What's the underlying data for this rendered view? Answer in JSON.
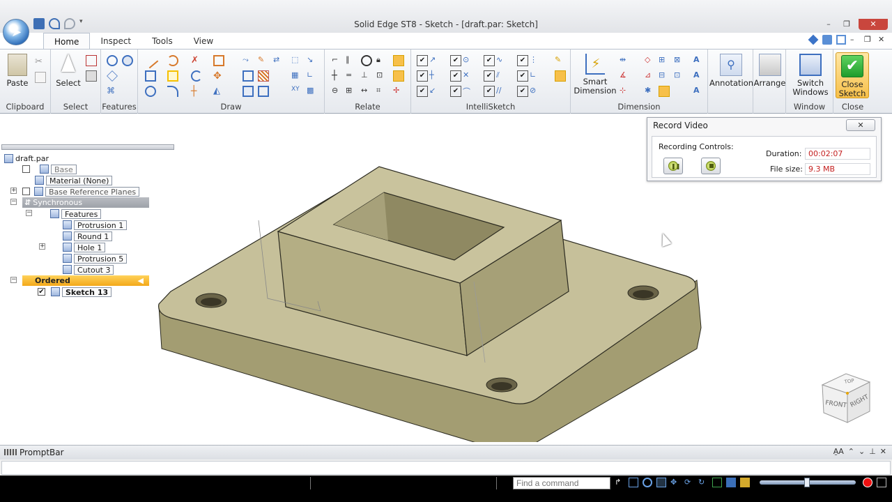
{
  "window": {
    "title": "Solid Edge ST8 - Sketch - [draft.par: Sketch]",
    "minimize": "–",
    "restore": "❐",
    "close": "✕"
  },
  "tabs": [
    {
      "label": "Home",
      "active": true
    },
    {
      "label": "Inspect"
    },
    {
      "label": "Tools"
    },
    {
      "label": "View"
    }
  ],
  "ribbon": {
    "groups": {
      "clipboard": "Clipboard",
      "select": "Select",
      "features": "Features",
      "draw": "Draw",
      "relate": "Relate",
      "intellisketch": "IntelliSketch",
      "dimension": "Dimension",
      "window": "Window",
      "close": "Close"
    },
    "buttons": {
      "paste": "Paste",
      "select": "Select",
      "smart_dimension_1": "Smart",
      "smart_dimension_2": "Dimension",
      "annotation": "Annotation",
      "arrange": "Arrange",
      "switch_windows_1": "Switch",
      "switch_windows_2": "Windows",
      "close_sketch_1": "Close",
      "close_sketch_2": "Sketch"
    }
  },
  "tree": {
    "root": "draft.par",
    "items": {
      "base": "Base",
      "material": "Material (None)",
      "base_ref_planes": "Base Reference Planes",
      "synchronous": "Synchronous",
      "features": "Features",
      "protrusion1": "Protrusion 1",
      "round1": "Round 1",
      "hole1": "Hole 1",
      "protrusion5": "Protrusion 5",
      "cutout3": "Cutout 3",
      "ordered": "Ordered",
      "sketch13": "Sketch 13"
    }
  },
  "record_video": {
    "title": "Record Video",
    "controls_label": "Recording Controls:",
    "duration_label": "Duration:",
    "duration_value": "00:02:07",
    "filesize_label": "File size:",
    "filesize_value": "9.3 MB"
  },
  "navcube": {
    "top": "TOP",
    "front": "FRONT",
    "right": "RIGHT"
  },
  "promptbar": {
    "title": "PromptBar"
  },
  "statusbar": {
    "find_placeholder": "Find a command"
  },
  "colors": {
    "model_face": "#b9b38a",
    "model_top": "#c6c09a",
    "model_side": "#a39d72",
    "accent_orange": "#f7c04a",
    "rec_value": "#c42020"
  }
}
